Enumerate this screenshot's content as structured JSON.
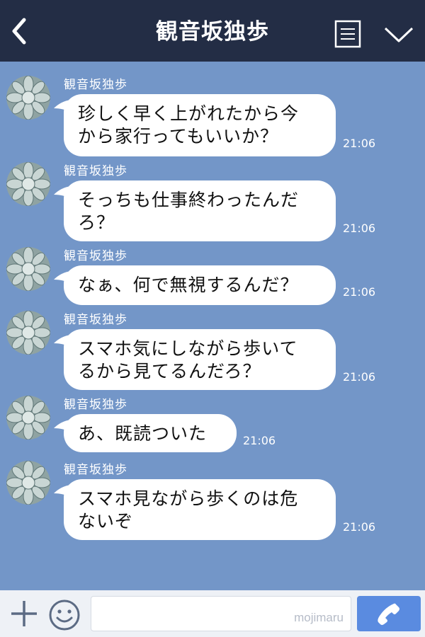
{
  "header": {
    "title": "観音坂独歩"
  },
  "messages": [
    {
      "sender": "観音坂独歩",
      "lines": [
        "珍しく早く上がれたから今",
        "から家行ってもいいか？"
      ],
      "time": "21:06"
    },
    {
      "sender": "観音坂独歩",
      "lines": [
        "そっちも仕事終わったんだ",
        "ろ？"
      ],
      "time": "21:06"
    },
    {
      "sender": "観音坂独歩",
      "lines": [
        "なぁ、何で無視するんだ？"
      ],
      "time": "21:06"
    },
    {
      "sender": "観音坂独歩",
      "lines": [
        "スマホ気にしながら歩いて",
        "るから見てるんだろ？"
      ],
      "time": "21:06"
    },
    {
      "sender": "観音坂独歩",
      "lines": [
        "あ、既読ついた"
      ],
      "time": "21:06"
    },
    {
      "sender": "観音坂独歩",
      "lines": [
        "スマホ見ながら歩くのは危",
        "ないぞ"
      ],
      "time": "21:06"
    }
  ],
  "footer": {
    "watermark": "mojimaru"
  },
  "icons": {
    "back": "chevron-left-icon",
    "menu": "note-list-icon",
    "more": "chevron-down-icon",
    "add": "plus-icon",
    "sticker": "smiley-icon",
    "call": "phone-icon"
  },
  "colors": {
    "header_bg": "#232d45",
    "chat_bg": "#7396c8",
    "bubble_bg": "#ffffff",
    "send_button": "#5a8be0"
  }
}
